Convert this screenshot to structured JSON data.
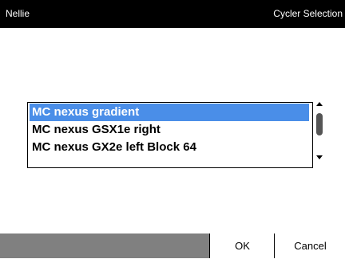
{
  "header": {
    "left_title": "Nellie",
    "right_title": "Cycler Selection"
  },
  "cycler_list": {
    "selected_index": 0,
    "items": [
      {
        "label": "MC nexus gradient"
      },
      {
        "label": "MC nexus GSX1e right"
      },
      {
        "label": "MC nexus GX2e left Block 64"
      }
    ]
  },
  "footer": {
    "ok_label": "OK",
    "cancel_label": "Cancel"
  },
  "colors": {
    "header_bg": "#000000",
    "selection": "#4a8ee8",
    "footer_bg": "#808080"
  }
}
